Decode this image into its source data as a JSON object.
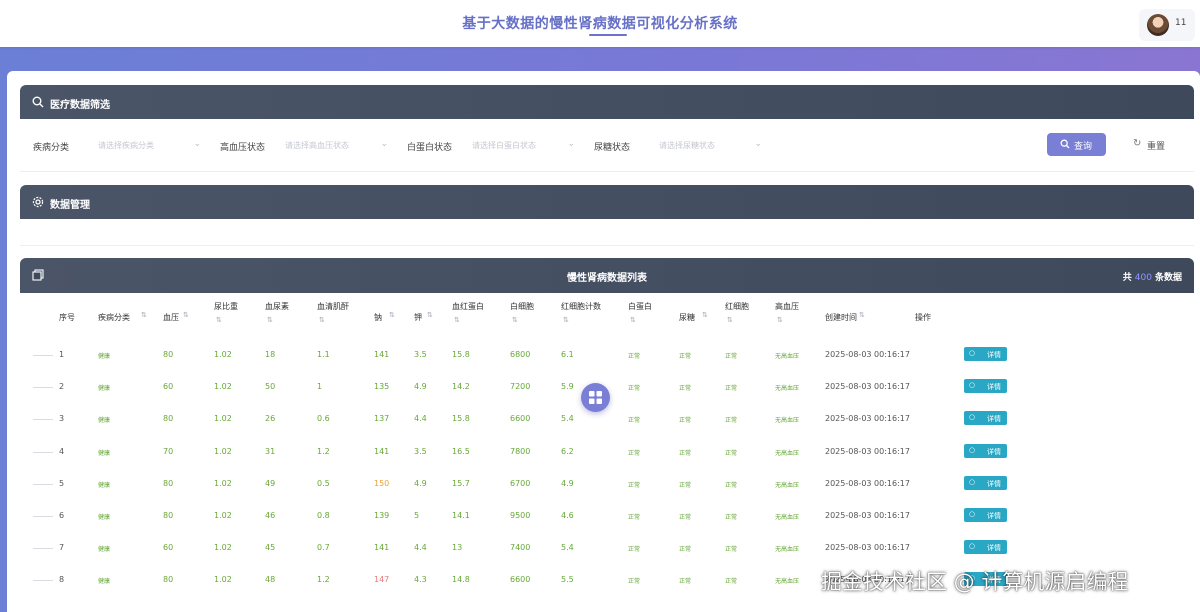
{
  "header": {
    "app_title": "基于大数据的慢性肾病数据可视化分析系统",
    "username": "11"
  },
  "filter_panel": {
    "title": "医疗数据筛选",
    "fields": [
      {
        "label": "疾病分类",
        "placeholder": "请选择疾病分类"
      },
      {
        "label": "高血压状态",
        "placeholder": "请选择高血压状态"
      },
      {
        "label": "白蛋白状态",
        "placeholder": "请选择白蛋白状态"
      },
      {
        "label": "尿糖状态",
        "placeholder": "请选择尿糖状态"
      }
    ],
    "query_label": "查询",
    "reset_label": "重置"
  },
  "manage_panel": {
    "title": "数据管理"
  },
  "list_panel": {
    "title": "慢性肾病数据列表",
    "count_prefix": "共",
    "count": "400",
    "count_suffix": "条数据"
  },
  "table": {
    "columns": [
      "序号",
      "疾病分类",
      "血压",
      "尿比重",
      "血尿素",
      "血清肌酐",
      "钠",
      "钾",
      "血红蛋白",
      "白细胞",
      "红细胞计数",
      "白蛋白",
      "尿糖",
      "红细胞",
      "高血压",
      "创建时间",
      "操作"
    ],
    "detail_label": "详情",
    "rows": [
      {
        "no": "1",
        "cls": "健康",
        "bp": "80",
        "sg": "1.02",
        "bu": "18",
        "sc": "1.1",
        "sod": "141",
        "pot": "3.5",
        "hemo": "15.8",
        "wbc": "6800",
        "rbc": "6.1",
        "alb": "正常",
        "su": "正常",
        "rbcs": "正常",
        "htn": "无高血压",
        "time": "2025-08-03 00:16:17"
      },
      {
        "no": "2",
        "cls": "健康",
        "bp": "60",
        "sg": "1.02",
        "bu": "50",
        "sc": "1",
        "sod": "135",
        "pot": "4.9",
        "hemo": "14.2",
        "wbc": "7200",
        "rbc": "5.9",
        "alb": "正常",
        "su": "正常",
        "rbcs": "正常",
        "htn": "无高血压",
        "time": "2025-08-03 00:16:17"
      },
      {
        "no": "3",
        "cls": "健康",
        "bp": "80",
        "sg": "1.02",
        "bu": "26",
        "sc": "0.6",
        "sod": "137",
        "pot": "4.4",
        "hemo": "15.8",
        "wbc": "6600",
        "rbc": "5.4",
        "alb": "正常",
        "su": "正常",
        "rbcs": "正常",
        "htn": "无高血压",
        "time": "2025-08-03 00:16:17"
      },
      {
        "no": "4",
        "cls": "健康",
        "bp": "70",
        "sg": "1.02",
        "bu": "31",
        "sc": "1.2",
        "sod": "141",
        "pot": "3.5",
        "hemo": "16.5",
        "wbc": "7800",
        "rbc": "6.2",
        "alb": "正常",
        "su": "正常",
        "rbcs": "正常",
        "htn": "无高血压",
        "time": "2025-08-03 00:16:17"
      },
      {
        "no": "5",
        "cls": "健康",
        "bp": "80",
        "sg": "1.02",
        "bu": "49",
        "sc": "0.5",
        "sod": "150",
        "pot": "4.9",
        "hemo": "15.7",
        "wbc": "6700",
        "rbc": "4.9",
        "alb": "正常",
        "su": "正常",
        "rbcs": "正常",
        "htn": "无高血压",
        "time": "2025-08-03 00:16:17"
      },
      {
        "no": "6",
        "cls": "健康",
        "bp": "80",
        "sg": "1.02",
        "bu": "46",
        "sc": "0.8",
        "sod": "139",
        "pot": "5",
        "hemo": "14.1",
        "wbc": "9500",
        "rbc": "4.6",
        "alb": "正常",
        "su": "正常",
        "rbcs": "正常",
        "htn": "无高血压",
        "time": "2025-08-03 00:16:17"
      },
      {
        "no": "7",
        "cls": "健康",
        "bp": "60",
        "sg": "1.02",
        "bu": "45",
        "sc": "0.7",
        "sod": "141",
        "pot": "4.4",
        "hemo": "13",
        "wbc": "7400",
        "rbc": "5.4",
        "alb": "正常",
        "su": "正常",
        "rbcs": "正常",
        "htn": "无高血压",
        "time": "2025-08-03 00:16:17"
      },
      {
        "no": "8",
        "cls": "健康",
        "bp": "80",
        "sg": "1.02",
        "bu": "48",
        "sc": "1.2",
        "sod": "147",
        "pot": "4.3",
        "hemo": "14.8",
        "wbc": "6600",
        "rbc": "5.5",
        "alb": "正常",
        "su": "正常",
        "rbcs": "正常",
        "htn": "无高血压",
        "time": "2025-08-03 00:16:17"
      }
    ]
  },
  "watermark": "掘金技术社区 @ 计算机源启编程"
}
